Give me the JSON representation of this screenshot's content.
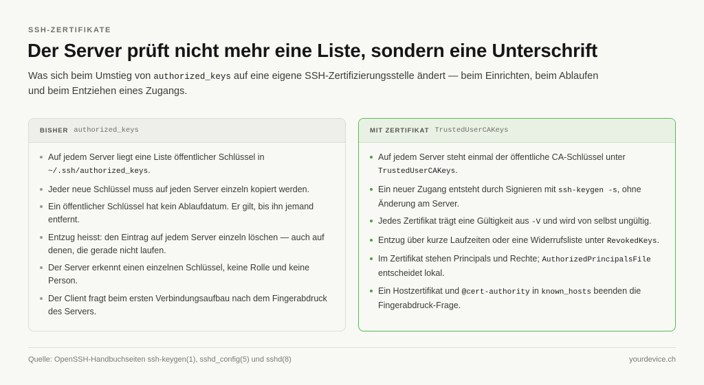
{
  "eyebrow": "SSH-ZERTIFIKATE",
  "title": "Der Server prüft nicht mehr eine Liste, sondern eine Unterschrift",
  "subtitle": [
    {
      "t": "Was sich beim Umstieg von "
    },
    {
      "code": "authorized_keys"
    },
    {
      "t": " auf eine eigene SSH-Zertifizierungsstelle ändert — beim Einrichten, beim Ablaufen und beim Entziehen eines Zugangs."
    }
  ],
  "before": {
    "label": "BISHER",
    "code": "authorized_keys",
    "items": [
      [
        {
          "t": "Auf jedem Server liegt eine Liste öffentlicher Schlüssel in "
        },
        {
          "code": "~/.ssh/authorized_keys"
        },
        {
          "t": "."
        }
      ],
      [
        {
          "t": "Jeder neue Schlüssel muss auf jeden Server einzeln kopiert werden."
        }
      ],
      [
        {
          "t": "Ein öffentlicher Schlüssel hat kein Ablaufdatum. Er gilt, bis ihn jemand entfernt."
        }
      ],
      [
        {
          "t": "Entzug heisst: den Eintrag auf jedem Server einzeln löschen — auch auf denen, die gerade nicht laufen."
        }
      ],
      [
        {
          "t": "Der Server erkennt einen einzelnen Schlüssel, keine Rolle und keine Person."
        }
      ],
      [
        {
          "t": "Der Client fragt beim ersten Verbindungsaufbau nach dem Fingerabdruck des Servers."
        }
      ]
    ]
  },
  "after": {
    "label": "MIT ZERTIFIKAT",
    "code": "TrustedUserCAKeys",
    "accent": "#3aa63f",
    "items": [
      [
        {
          "t": "Auf jedem Server steht einmal der öffentliche CA-Schlüssel unter "
        },
        {
          "code": "TrustedUserCAKeys"
        },
        {
          "t": "."
        }
      ],
      [
        {
          "t": "Ein neuer Zugang entsteht durch Signieren mit "
        },
        {
          "code": "ssh-keygen -s"
        },
        {
          "t": ", ohne Änderung am Server."
        }
      ],
      [
        {
          "t": "Jedes Zertifikat trägt eine Gültigkeit aus "
        },
        {
          "code": "-V"
        },
        {
          "t": " und wird von selbst ungültig."
        }
      ],
      [
        {
          "t": "Entzug über kurze Laufzeiten oder eine Widerrufsliste unter "
        },
        {
          "code": "RevokedKeys"
        },
        {
          "t": "."
        }
      ],
      [
        {
          "t": "Im Zertifikat stehen Principals und Rechte; "
        },
        {
          "code": "AuthorizedPrincipalsFile"
        },
        {
          "t": " entscheidet lokal."
        }
      ],
      [
        {
          "t": "Ein Hostzertifikat und "
        },
        {
          "code": "@cert-authority"
        },
        {
          "t": " in "
        },
        {
          "code": "known_hosts"
        },
        {
          "t": " beenden die Fingerabdruck-Frage."
        }
      ]
    ]
  },
  "footer": {
    "source": "Quelle: OpenSSH-Handbuchseiten ssh-keygen(1), sshd_config(5) und sshd(8)",
    "site": "yourdevice.ch"
  }
}
